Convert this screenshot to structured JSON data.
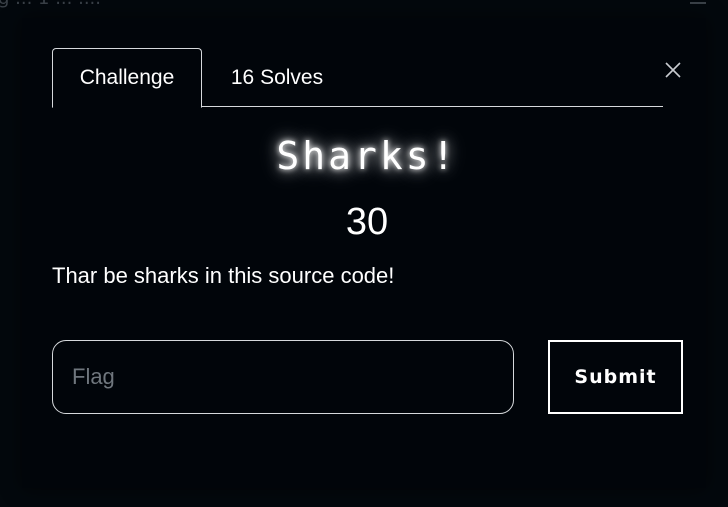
{
  "background": {
    "partial_text": "g ... 1 ... ...."
  },
  "modal": {
    "tabs": [
      {
        "label": "Challenge",
        "active": true
      },
      {
        "label": "16 Solves",
        "active": false
      }
    ],
    "close_icon": "close-icon",
    "title": "Sharks!",
    "points": "30",
    "description": "Thar be sharks in this source code!",
    "flag": {
      "value": "",
      "placeholder": "Flag"
    },
    "submit_label": "Submit"
  },
  "colors": {
    "background": "#03080d",
    "modal": "#01050a",
    "text": "#ffffff",
    "border": "#d6d9dc",
    "placeholder": "#6f767d"
  }
}
